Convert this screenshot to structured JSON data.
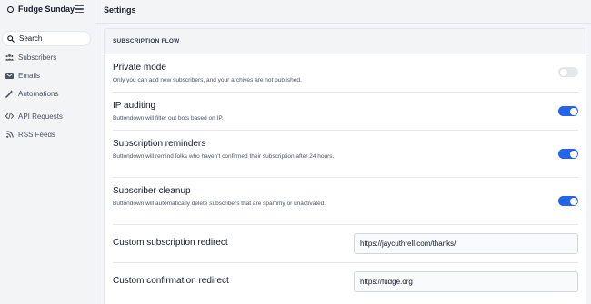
{
  "app": {
    "name": "Fudge Sunday"
  },
  "sidebar": {
    "search_label": "Search",
    "items": [
      {
        "label": "Subscribers",
        "icon": "users-icon"
      },
      {
        "label": "Emails",
        "icon": "mail-icon"
      },
      {
        "label": "Automations",
        "icon": "wand-icon"
      },
      {
        "label": "API Requests",
        "icon": "code-icon"
      },
      {
        "label": "RSS Feeds",
        "icon": "rss-icon"
      }
    ]
  },
  "header": {
    "title": "Settings"
  },
  "section": {
    "title": "SUBSCRIPTION FLOW",
    "settings": [
      {
        "title": "Private mode",
        "description": "Only you can add new subscribers, and your archives are not published.",
        "enabled": false
      },
      {
        "title": "IP auditing",
        "description": "Buttondown will filter out bots based on IP.",
        "enabled": true
      },
      {
        "title": "Subscription reminders",
        "description": "Buttondown will remind folks who haven't confirmed their subscription after 24 hours.",
        "enabled": true
      },
      {
        "title": "Subscriber cleanup",
        "description": "Buttondown will automatically delete subscribers that are spammy or unactivated.",
        "enabled": true
      }
    ],
    "redirects": [
      {
        "label": "Custom subscription redirect",
        "value": "https://jaycuthrell.com/thanks/"
      },
      {
        "label": "Custom confirmation redirect",
        "value": "https://fudge.org"
      }
    ]
  },
  "colors": {
    "accent": "#2563eb",
    "toggle_off": "#e5e7eb"
  }
}
